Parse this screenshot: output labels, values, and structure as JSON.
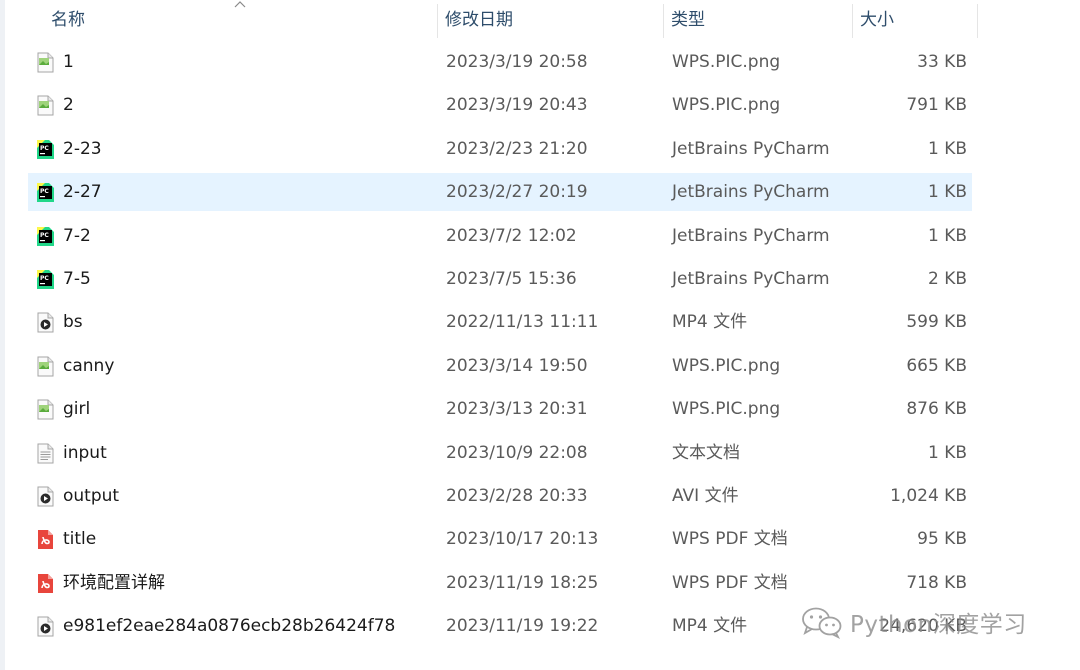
{
  "columns": {
    "name": "名称",
    "date": "修改日期",
    "type": "类型",
    "size": "大小"
  },
  "files": [
    {
      "name": "1",
      "date": "2023/3/19 20:58",
      "type": "WPS.PIC.png",
      "size": "33 KB",
      "icon": "image-file-icon",
      "selected": false
    },
    {
      "name": "2",
      "date": "2023/3/19 20:43",
      "type": "WPS.PIC.png",
      "size": "791 KB",
      "icon": "image-file-icon",
      "selected": false
    },
    {
      "name": "2-23",
      "date": "2023/2/23 21:20",
      "type": "JetBrains PyCharm",
      "size": "1 KB",
      "icon": "pycharm-file-icon",
      "selected": false
    },
    {
      "name": "2-27",
      "date": "2023/2/27 20:19",
      "type": "JetBrains PyCharm",
      "size": "1 KB",
      "icon": "pycharm-file-icon",
      "selected": true
    },
    {
      "name": "7-2",
      "date": "2023/7/2 12:02",
      "type": "JetBrains PyCharm",
      "size": "1 KB",
      "icon": "pycharm-file-icon",
      "selected": false
    },
    {
      "name": "7-5",
      "date": "2023/7/5 15:36",
      "type": "JetBrains PyCharm",
      "size": "2 KB",
      "icon": "pycharm-file-icon",
      "selected": false
    },
    {
      "name": "bs",
      "date": "2022/11/13 11:11",
      "type": "MP4 文件",
      "size": "599 KB",
      "icon": "video-file-icon",
      "selected": false
    },
    {
      "name": "canny",
      "date": "2023/3/14 19:50",
      "type": "WPS.PIC.png",
      "size": "665 KB",
      "icon": "image-file-icon",
      "selected": false
    },
    {
      "name": "girl",
      "date": "2023/3/13 20:31",
      "type": "WPS.PIC.png",
      "size": "876 KB",
      "icon": "image-file-icon",
      "selected": false
    },
    {
      "name": "input",
      "date": "2023/10/9 22:08",
      "type": "文本文档",
      "size": "1 KB",
      "icon": "text-file-icon",
      "selected": false
    },
    {
      "name": "output",
      "date": "2023/2/28 20:33",
      "type": "AVI 文件",
      "size": "1,024 KB",
      "icon": "video-file-icon",
      "selected": false
    },
    {
      "name": "title",
      "date": "2023/10/17 20:13",
      "type": "WPS PDF 文档",
      "size": "95 KB",
      "icon": "pdf-file-icon",
      "selected": false
    },
    {
      "name": "环境配置详解",
      "date": "2023/11/19 18:25",
      "type": "WPS PDF 文档",
      "size": "718 KB",
      "icon": "pdf-file-icon",
      "selected": false
    },
    {
      "name": "e981ef2eae284a0876ecb28b26424f78",
      "date": "2023/11/19 19:22",
      "type": "MP4 文件",
      "size": "24,620 KB",
      "icon": "video-file-icon",
      "selected": false
    }
  ],
  "watermark": {
    "text": "Python深度学习",
    "icon": "wechat-icon"
  },
  "colors": {
    "header_text": "#2e4d6b",
    "selected_row": "#e5f3ff",
    "pycharm_green": "#21d789",
    "pdf_red": "#e8453c"
  }
}
